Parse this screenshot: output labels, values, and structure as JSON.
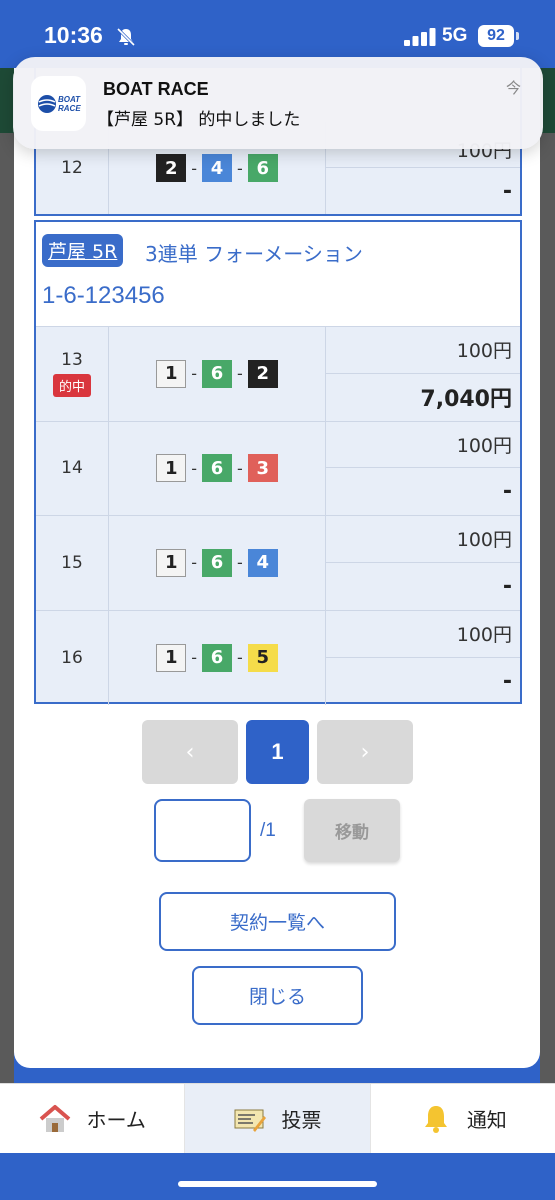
{
  "status": {
    "time": "10:36",
    "network": "5G",
    "battery": "92"
  },
  "notification": {
    "app": "BOAT RACE",
    "body": "【芦屋 5R】 的中しました",
    "time": "今",
    "logo_text": "BOAT RACE"
  },
  "table_top": {
    "rows": [
      {
        "num": "12",
        "boats": [
          "2",
          "4",
          "6"
        ],
        "stake": "100円",
        "payout": "-"
      }
    ]
  },
  "race": {
    "venue": "芦屋 5R",
    "bet_type": "3連単 フォーメーション",
    "combination": "1-6-123456",
    "hit_label": "的中",
    "rows": [
      {
        "num": "13",
        "boats": [
          "1",
          "6",
          "2"
        ],
        "stake": "100円",
        "payout": "7,040円",
        "hit": true
      },
      {
        "num": "14",
        "boats": [
          "1",
          "6",
          "3"
        ],
        "stake": "100円",
        "payout": "-"
      },
      {
        "num": "15",
        "boats": [
          "1",
          "6",
          "4"
        ],
        "stake": "100円",
        "payout": "-"
      },
      {
        "num": "16",
        "boats": [
          "1",
          "6",
          "5"
        ],
        "stake": "100円",
        "payout": "-"
      }
    ]
  },
  "boat_colors": {
    "1": {
      "bg": "#f4f4f4",
      "fg": "#222222"
    },
    "2": {
      "bg": "#222222",
      "fg": "#ffffff"
    },
    "3": {
      "bg": "#e0605a",
      "fg": "#ffffff"
    },
    "4": {
      "bg": "#4a86d8",
      "fg": "#ffffff"
    },
    "5": {
      "bg": "#f5dc4a",
      "fg": "#222222"
    },
    "6": {
      "bg": "#48a868",
      "fg": "#ffffff"
    }
  },
  "pagination": {
    "prev": "‹",
    "current": "1",
    "next": "›",
    "total": "/1",
    "move": "移動"
  },
  "actions": {
    "contract_list": "契約一覧へ",
    "close": "閉じる"
  },
  "nav": {
    "home": "ホーム",
    "vote": "投票",
    "notify": "通知"
  },
  "colors": {
    "brand": "#2f62c8",
    "accent": "#3a6cc9",
    "hit": "#d9363e"
  }
}
